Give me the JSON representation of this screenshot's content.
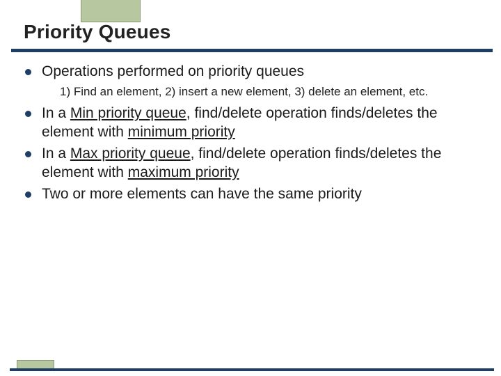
{
  "title": "Priority Queues",
  "bullets": [
    {
      "text": "Operations performed on priority queues",
      "sub": "1) Find an element, 2) insert a new element, 3) delete an element, etc."
    },
    {
      "segments": [
        {
          "t": "In a ",
          "u": false
        },
        {
          "t": "Min priority queue",
          "u": true
        },
        {
          "t": ", find/delete operation finds/deletes the element with ",
          "u": false
        },
        {
          "t": "minimum priority",
          "u": true
        }
      ]
    },
    {
      "segments": [
        {
          "t": "In a ",
          "u": false
        },
        {
          "t": "Max priority queue",
          "u": true
        },
        {
          "t": ", find/delete operation finds/deletes the element with ",
          "u": false
        },
        {
          "t": "maximum priority",
          "u": true
        }
      ]
    },
    {
      "text": "Two or more elements can have the same priority"
    }
  ]
}
